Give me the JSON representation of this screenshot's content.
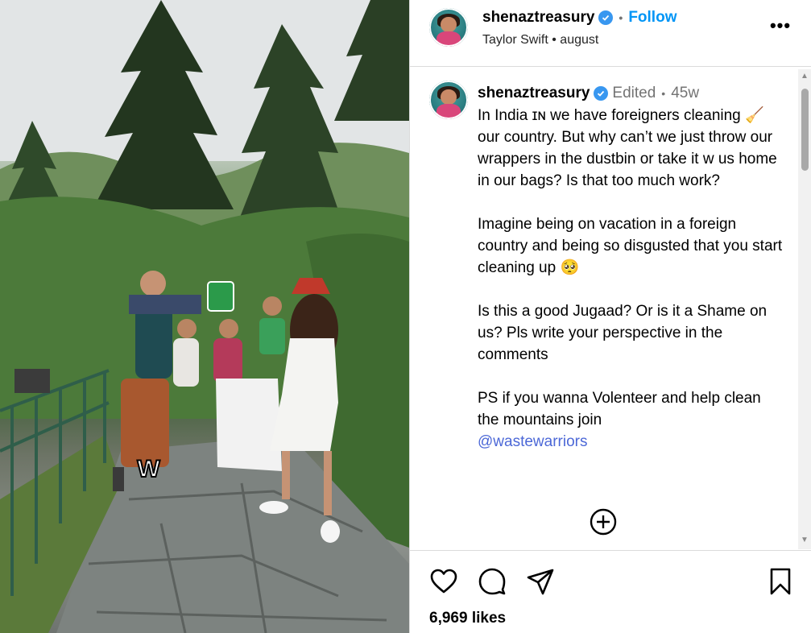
{
  "post": {
    "username": "shenaztreasury",
    "follow_label": "Follow",
    "audio": "Taylor Swift",
    "location": "august",
    "sticker_text": "W"
  },
  "caption": {
    "username": "shenaztreasury",
    "edited_label": "Edited",
    "time_ago": "45w",
    "text": "In India ɪɴ we have foreigners cleaning 🧹 our country. But why can’t we just throw our wrappers in the dustbin or take it w us home in our bags? Is that too much work?\n\nImagine being on vacation in a foreign country and being so disgusted that you start cleaning up 🥺\n\nIs this a good Jugaad? Or is it a Shame on us? Pls write your perspective in the comments\n\nPS if you wanna Volenteer and help clean the mountains join",
    "mention": "@wastewarriors"
  },
  "engagement": {
    "likes": "6,969 likes"
  },
  "icons": {
    "verified": "verified-badge-icon",
    "more": "more-options-icon",
    "like": "heart-icon",
    "comment": "comment-icon",
    "share": "share-icon",
    "save": "bookmark-icon",
    "expand": "plus-circle-icon"
  },
  "colors": {
    "link": "#0095f6",
    "mention": "#4c68d7",
    "verified": "#3897f0",
    "muted": "#737373"
  }
}
